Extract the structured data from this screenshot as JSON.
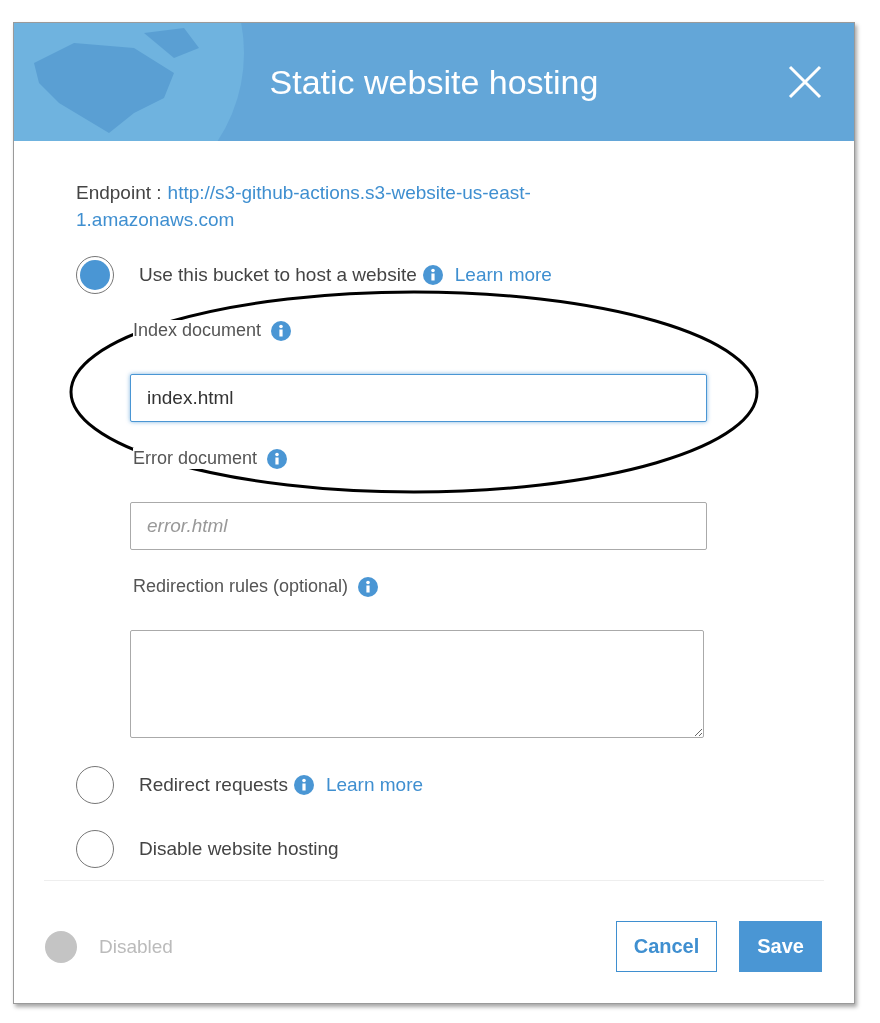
{
  "dialog": {
    "title": "Static website hosting",
    "endpoint": {
      "label": "Endpoint :",
      "url": "http://s3-github-actions.s3-website-us-east-1.amazonaws.com"
    },
    "options": [
      {
        "label": "Use this bucket to host a website",
        "info": true,
        "link": "Learn more",
        "selected": true,
        "fields": [
          {
            "label": "Index document",
            "info": true,
            "kind": "input",
            "value": "index.html",
            "focused": true
          },
          {
            "label": "Error document",
            "info": true,
            "kind": "input",
            "placeholder": "error.html",
            "focused": false
          },
          {
            "label": "Redirection rules (optional)",
            "info": true,
            "kind": "textarea",
            "focused": false
          }
        ]
      },
      {
        "label": "Redirect requests",
        "info": true,
        "link": "Learn more",
        "selected": false
      },
      {
        "label": "Disable website hosting",
        "info": false,
        "selected": false
      }
    ],
    "status": {
      "label": "Disabled",
      "on": false
    },
    "buttons": [
      {
        "label": "Cancel",
        "kind": "secondary"
      },
      {
        "label": "Save",
        "kind": "primary"
      }
    ]
  },
  "annotation": {
    "kind": "ellipse"
  }
}
